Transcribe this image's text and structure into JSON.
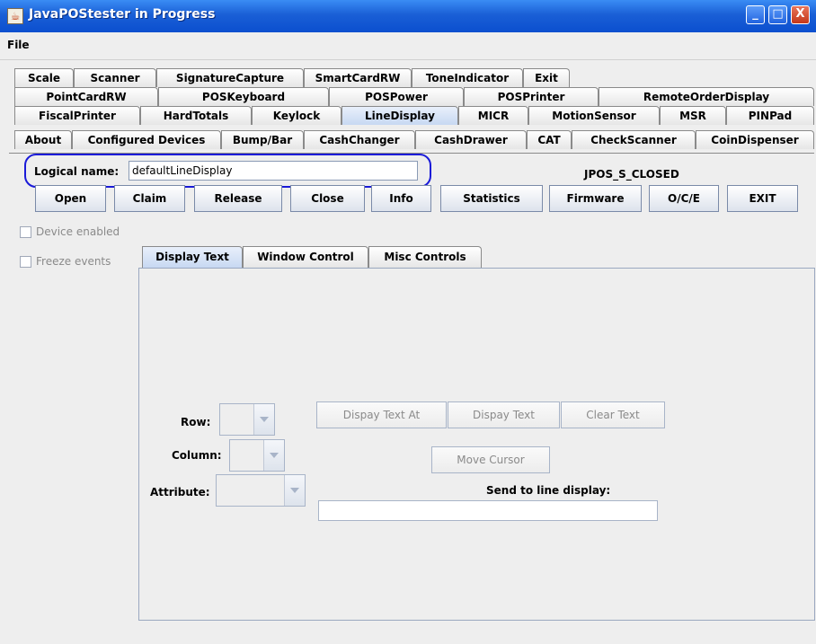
{
  "window": {
    "title": "JavaPOStester in Progress",
    "app_icon": "java-cup-icon"
  },
  "window_controls": {
    "minimize": "_",
    "maximize": "□",
    "close": "X"
  },
  "menu": {
    "file": "File"
  },
  "tabs": {
    "row1": [
      "Scale",
      "Scanner",
      "SignatureCapture",
      "SmartCardRW",
      "ToneIndicator",
      "Exit"
    ],
    "row2": [
      "PointCardRW",
      "POSKeyboard",
      "POSPower",
      "POSPrinter",
      "RemoteOrderDisplay"
    ],
    "row3": [
      "FiscalPrinter",
      "HardTotals",
      "Keylock",
      "LineDisplay",
      "MICR",
      "MotionSensor",
      "MSR",
      "PINPad"
    ],
    "row4": [
      "About",
      "Configured Devices",
      "Bump/Bar",
      "CashChanger",
      "CashDrawer",
      "CAT",
      "CheckScanner",
      "CoinDispenser"
    ],
    "active": "LineDisplay"
  },
  "logical_name": {
    "label": "Logical name:",
    "value": "defaultLineDisplay"
  },
  "status": "JPOS_S_CLOSED",
  "buttons": [
    "Open",
    "Claim",
    "Release",
    "Close",
    "Info",
    "Statistics",
    "Firmware",
    "O/C/E",
    "EXIT"
  ],
  "checkboxes": {
    "device_enabled": "Device enabled",
    "freeze_events": "Freeze events"
  },
  "inner_tabs": {
    "items": [
      "Display Text",
      "Window Control",
      "Misc Controls"
    ],
    "active": "Display Text"
  },
  "display_text": {
    "row_label": "Row:",
    "column_label": "Column:",
    "attribute_label": "Attribute:",
    "display_text_at": "Dispay Text At",
    "display_text": "Dispay Text",
    "clear_text": "Clear Text",
    "move_cursor": "Move Cursor",
    "send_label": "Send to line display:",
    "send_value": ""
  },
  "colors": {
    "titlebar": "#0b4fcf",
    "highlight_outline": "#1a1ad8",
    "active_tab": "#c7d8f2"
  }
}
